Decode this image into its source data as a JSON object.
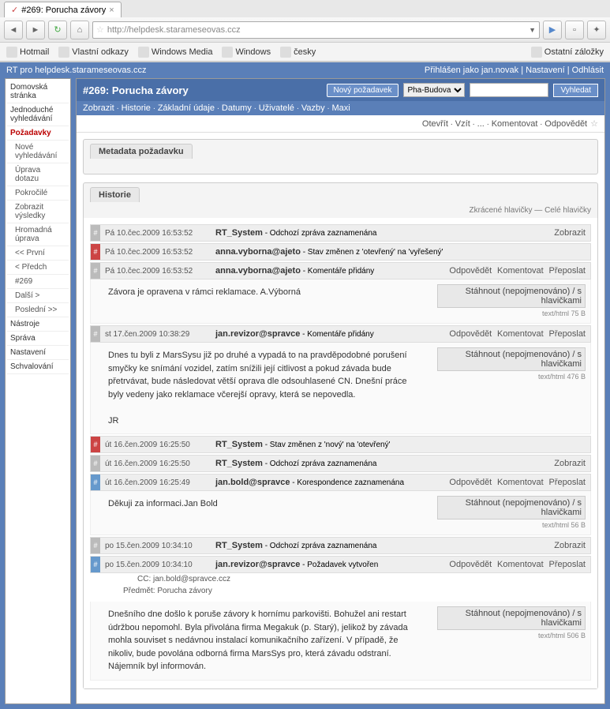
{
  "browser": {
    "tab_title": "#269: Porucha závory",
    "url": "http://helpdesk.starameseovas.ccz",
    "bookmarks": [
      "Hotmail",
      "Vlastní odkazy",
      "Windows Media",
      "Windows",
      "česky"
    ],
    "other_bookmarks": "Ostatní záložky"
  },
  "app_header": {
    "left": "RT pro helpdesk.starameseovas.ccz",
    "right_login": "Přihlášen jako jan.novak",
    "right_settings": "Nastavení",
    "right_logout": "Odhlásit"
  },
  "sidebar": [
    {
      "t": "Domovská stránka"
    },
    {
      "t": "Jednoduché vyhledávání"
    },
    {
      "t": "Požadavky",
      "sel": true
    },
    {
      "t": "Nové vyhledávání",
      "i": true
    },
    {
      "t": "Úprava dotazu",
      "i": true
    },
    {
      "t": "Pokročilé",
      "i": true
    },
    {
      "t": "Zobrazit výsledky",
      "i": true
    },
    {
      "t": "Hromadná úprava",
      "i": true
    },
    {
      "t": "<< První",
      "i": true
    },
    {
      "t": "< Předch",
      "i": true
    },
    {
      "t": "#269",
      "i": true
    },
    {
      "t": "Další >",
      "i": true
    },
    {
      "t": "Poslední >>",
      "i": true
    },
    {
      "t": "Nástroje"
    },
    {
      "t": "Správa"
    },
    {
      "t": "Nastavení"
    },
    {
      "t": "Schvalování"
    }
  ],
  "ticket": {
    "title": "#269: Porucha závory",
    "new_request": "Nový požadavek",
    "queue_option": "Pha-Budova",
    "search_btn": "Vyhledat",
    "submenu": [
      "Zobrazit",
      "Historie",
      "Základní údaje",
      "Datumy",
      "Uživatelé",
      "Vazby",
      "Maxi"
    ],
    "actions": [
      "Otevřít",
      "Vzít",
      "...",
      "Komentovat",
      "Odpovědět"
    ],
    "metadata_label": "Metadata požadavku",
    "history_label": "Historie",
    "hist_toggle": "Zkrácené hlavičky — Celé hlavičky"
  },
  "labels": {
    "zobrazit": "Zobrazit",
    "odpovedet": "Odpovědět",
    "komentovat": "Komentovat",
    "preposlat": "Přeposlat",
    "download": "Stáhnout (nepojmenováno) / s hlavičkami",
    "cc": "CC:",
    "subject": "Předmět:"
  },
  "entries": [
    {
      "m": "gray",
      "date": "Pá 10.čec.2009 16:53:52",
      "who": "RT_System",
      "what": "- Odchozí zpráva zaznamenána",
      "acts": [
        "zobrazit"
      ]
    },
    {
      "m": "red",
      "date": "Pá 10.čec.2009 16:53:52",
      "who": "anna.vyborna@ajeto",
      "what": "- Stav změnen z 'otevřený' na 'vyřešený'"
    },
    {
      "m": "gray",
      "date": "Pá 10.čec.2009 16:53:52",
      "who": "anna.vyborna@ajeto",
      "what": "- Komentáře přidány",
      "acts": [
        "odpovedet",
        "komentovat",
        "preposlat"
      ],
      "body": "Závora je opravena v rámci reklamace. A.Výborná",
      "dl": "text/html 75 B"
    },
    {
      "m": "gray",
      "date": "st 17.čen.2009 10:38:29",
      "who": "jan.revizor@spravce",
      "what": "- Komentáře přidány",
      "acts": [
        "odpovedet",
        "komentovat",
        "preposlat"
      ],
      "body": "Dnes tu byli z MarsSysu již po druhé a vypadá to na pravděpodobné porušení smyčky ke snímání vozidel, zatím snížili její citlivost a pokud závada bude přetrvávat, bude následovat větší oprava dle odsouhlasené CN. Dnešní práce byly vedeny jako reklamace včerejší opravy, která se nepovedla.\n\nJR",
      "dl": "text/html 476 B"
    },
    {
      "m": "red",
      "date": "út 16.čen.2009 16:25:50",
      "who": "RT_System",
      "what": "- Stav změnen z 'nový' na 'otevřený'"
    },
    {
      "m": "gray",
      "date": "út 16.čen.2009 16:25:50",
      "who": "RT_System",
      "what": "- Odchozí zpráva zaznamenána",
      "acts": [
        "zobrazit"
      ]
    },
    {
      "m": "blue",
      "date": "út 16.čen.2009 16:25:49",
      "who": "jan.bold@spravce",
      "what": "- Korespondence zaznamenána",
      "acts": [
        "odpovedet",
        "komentovat",
        "preposlat"
      ],
      "body": "Děkuji za informaci.Jan Bold",
      "dl": "text/html 56 B"
    },
    {
      "m": "gray",
      "date": "po 15.čen.2009 10:34:10",
      "who": "RT_System",
      "what": "- Odchozí zpráva zaznamenána",
      "acts": [
        "zobrazit"
      ]
    },
    {
      "m": "blue",
      "date": "po 15.čen.2009 10:34:10",
      "who": "jan.revizor@spravce",
      "what": "- Požadavek vytvořen",
      "acts": [
        "odpovedet",
        "komentovat",
        "preposlat"
      ],
      "cc": "jan.bold@spravce.ccz",
      "subject": "Porucha závory",
      "body": "Dnešního dne došlo k poruše závory k hornímu parkovišti. Bohužel ani restart údržbou nepomohl. Byla přivolána firma Megakuk (p. Starý), jelikož by závada mohla souviset s nedávnou instalací komunikačního zařízení. V případě, že nikoliv, bude povolána odborná firma MarsSys pro, která závadu odstraní. Nájemník byl informován.",
      "dl": "text/html 506 B"
    }
  ]
}
